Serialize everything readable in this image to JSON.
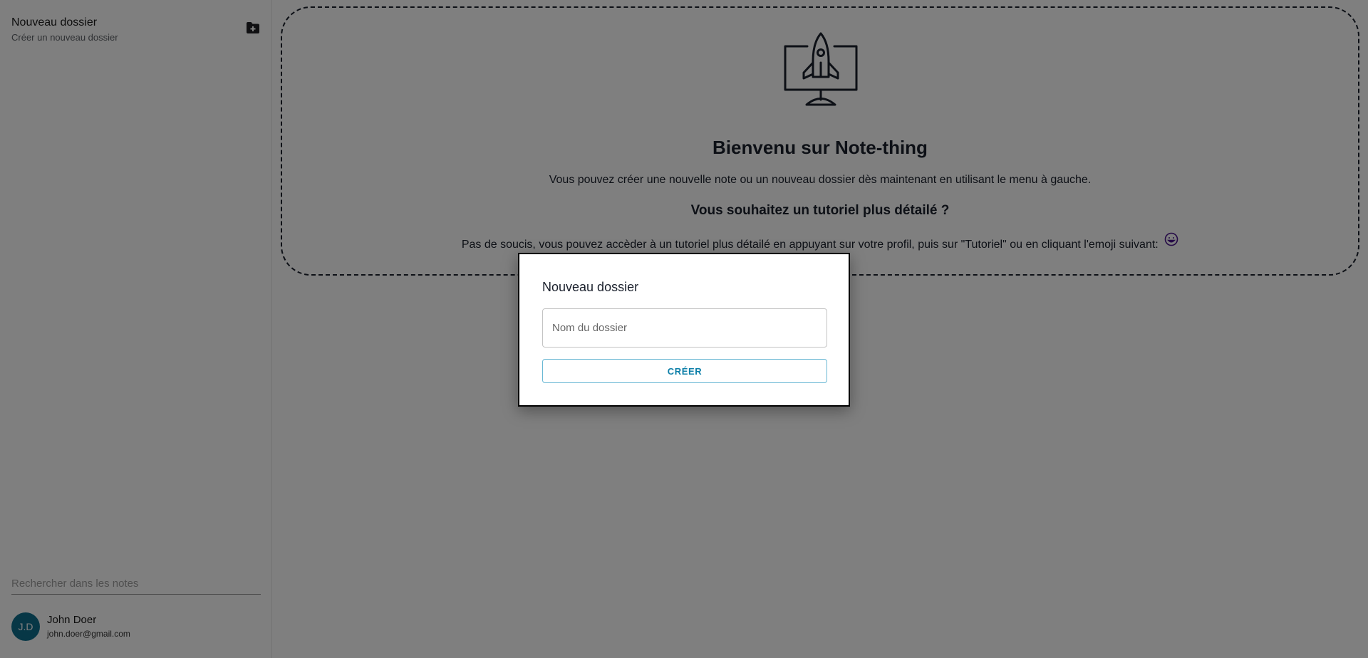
{
  "sidebar": {
    "new_folder": {
      "title": "Nouveau dossier",
      "subtitle": "Créer un nouveau dossier",
      "icon": "folder-add-icon"
    },
    "search": {
      "placeholder": "Rechercher dans les notes"
    },
    "profile": {
      "initials": "J.D",
      "name": "John Doer",
      "email": "john.doer@gmail.com",
      "avatar_color": "#0e6e8c"
    }
  },
  "main": {
    "icon": "rocket-monitor-icon",
    "title": "Bienvenu sur Note-thing",
    "text": "Vous pouvez créer une nouvelle note ou un nouveau dossier dès maintenant en utilisant le menu à gauche.",
    "tutorial_title": "Vous souhaitez un tutoriel plus détailé ?",
    "tutorial_text": "Pas de soucis, vous pouvez accèder à un tutoriel plus détailé en appuyant sur votre profil, puis sur \"Tutoriel\" ou en cliquant l'emoji suivant:",
    "emoji_icon": "smile-icon"
  },
  "modal": {
    "title": "Nouveau dossier",
    "input_placeholder": "Nom du dossier",
    "input_value": "",
    "button_label": "CRÉER",
    "accent_color": "#0d7fa8"
  }
}
